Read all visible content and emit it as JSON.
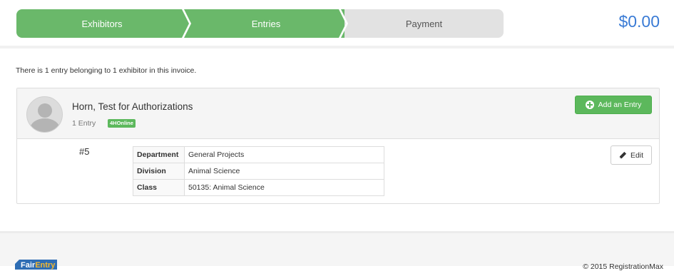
{
  "steps": [
    {
      "label": "Exhibitors",
      "state": "complete"
    },
    {
      "label": "Entries",
      "state": "active"
    },
    {
      "label": "Payment",
      "state": "pending"
    }
  ],
  "invoice_total": "$0.00",
  "intro_text": "There is 1 entry belonging to 1 exhibitor in this invoice.",
  "exhibitor": {
    "name": "Horn, Test for Authorizations",
    "entry_count": "1 Entry",
    "badge": "4HOnline",
    "add_entry_label": "Add an Entry"
  },
  "entry": {
    "number": "#5",
    "rows": [
      {
        "key": "Department",
        "value": "General Projects"
      },
      {
        "key": "Division",
        "value": "Animal Science"
      },
      {
        "key": "Class",
        "value": "50135: Animal Science"
      }
    ],
    "edit_label": "Edit"
  },
  "footer": {
    "logo_part1": "Fair",
    "logo_part2": "Entry",
    "copyright": "© 2015 RegistrationMax"
  },
  "colors": {
    "step_complete": "#6ab86a",
    "step_pending": "#e2e2e2",
    "total": "#3a7bd5",
    "success": "#5cb85c",
    "logo_blue": "#2e6db4",
    "logo_orange": "#f5b82e"
  },
  "icons": [
    "plus-circle-icon",
    "pencil-icon",
    "user-avatar-icon"
  ]
}
